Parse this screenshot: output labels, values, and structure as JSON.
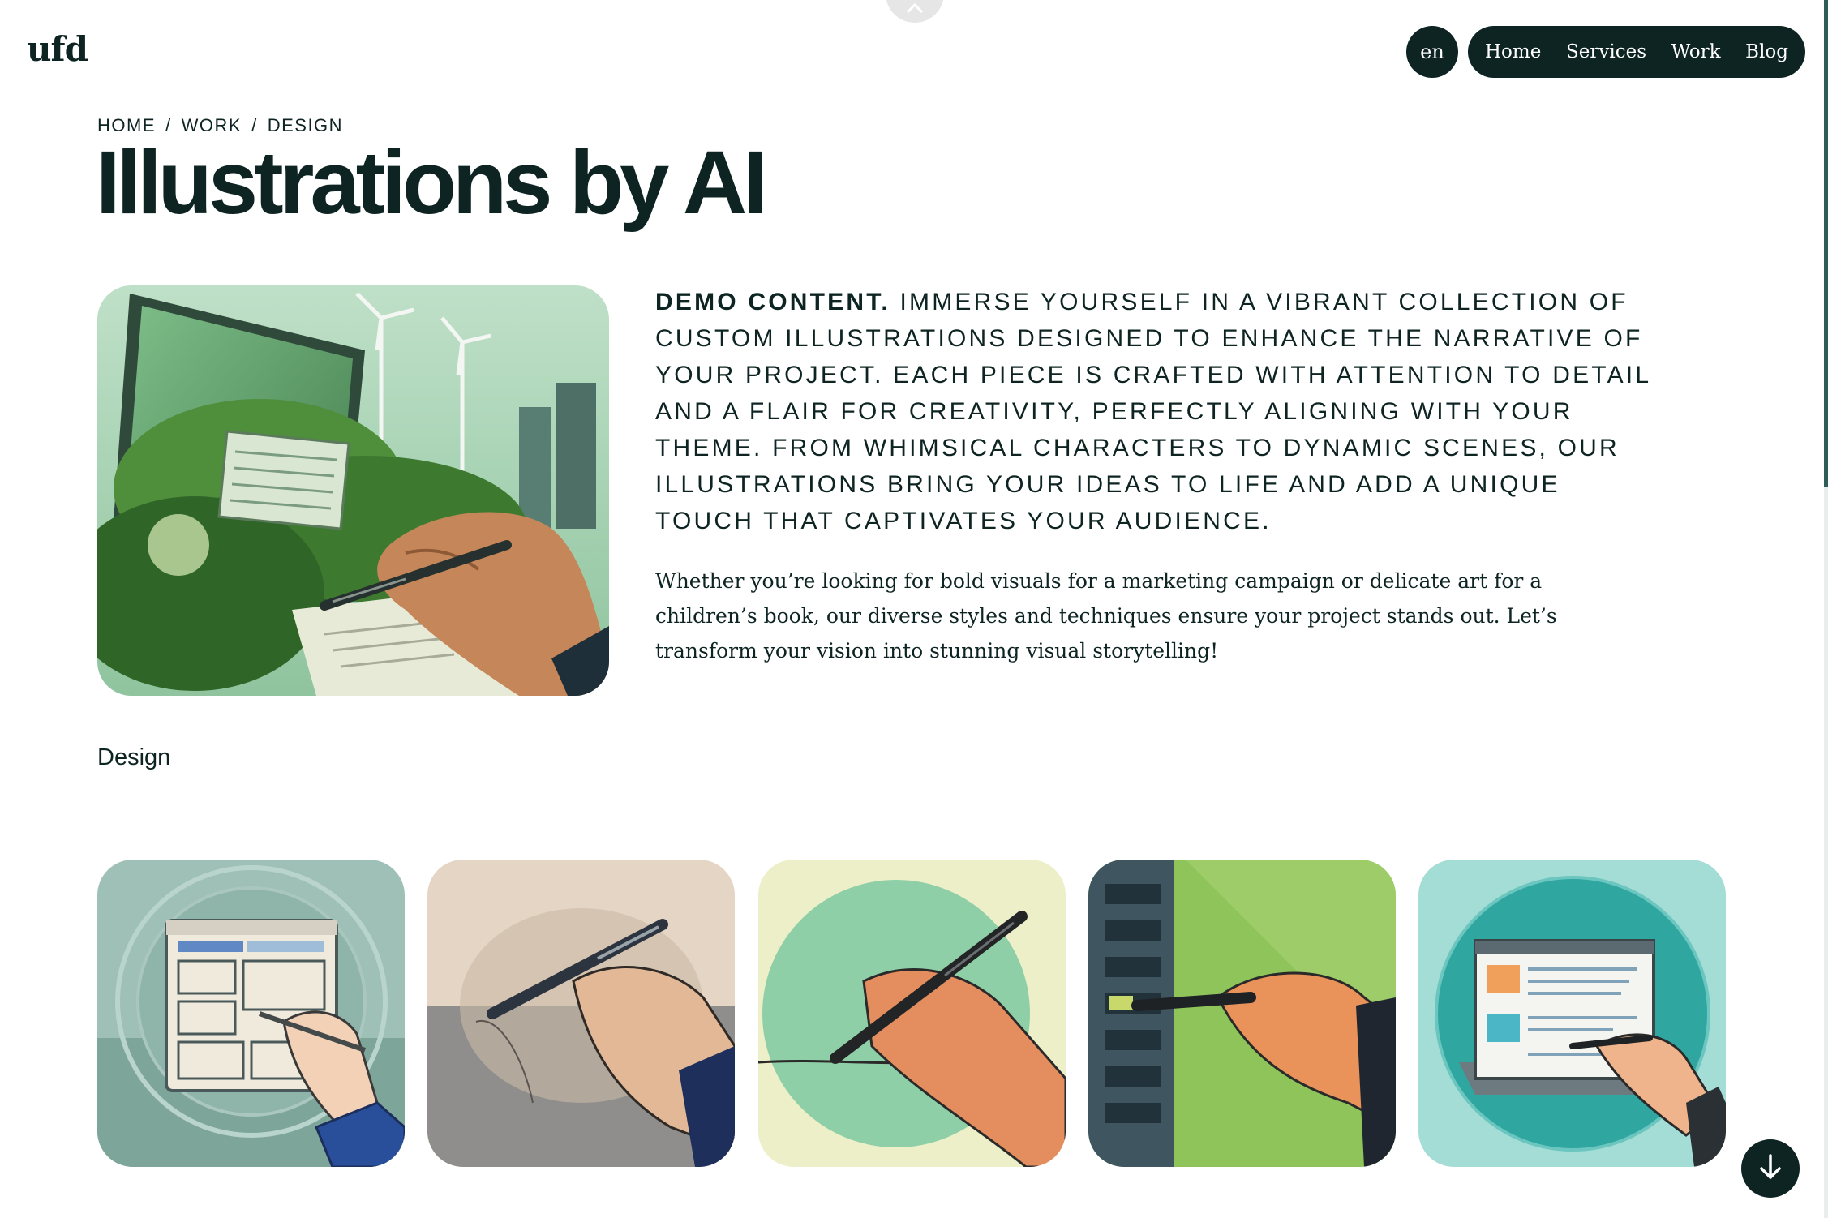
{
  "header": {
    "logo": "ufd",
    "language": "en",
    "nav": [
      "Home",
      "Services",
      "Work",
      "Blog"
    ]
  },
  "breadcrumb": {
    "items": [
      "HOME",
      "WORK",
      "DESIGN"
    ],
    "separator": "/"
  },
  "page_title": "Illustrations by AI",
  "intro": {
    "lead_bold": "DEMO CONTENT.",
    "lead_text": "IMMERSE YOURSELF IN A VIBRANT COLLECTION OF CUSTOM ILLUSTRATIONS DESIGNED TO ENHANCE THE NARRATIVE OF YOUR PROJECT. EACH PIECE IS CRAFTED WITH ATTENTION TO DETAIL AND A FLAIR FOR CREATIVITY, PERFECTLY ALIGNING WITH YOUR THEME. FROM WHIMSICAL CHARACTERS TO DYNAMIC SCENES, OUR ILLUSTRATIONS BRING YOUR IDEAS TO LIFE AND ADD A UNIQUE TOUCH THAT CAPTIVATES YOUR AUDIENCE.",
    "body": "Whether you’re looking for bold visuals for a marketing campaign or delicate art for a children’s book, our diverse styles and techniques ensure your project stands out. Let’s transform your vision into stunning visual storytelling!"
  },
  "category_tag": "Design",
  "gallery": [
    {
      "icon": "wireframe-hand-illustration"
    },
    {
      "icon": "pen-hand-halftone-illustration"
    },
    {
      "icon": "pen-hand-green-circle-illustration"
    },
    {
      "icon": "server-rack-hand-illustration"
    },
    {
      "icon": "webpage-hand-teal-illustration"
    }
  ],
  "icons": {
    "top": "chevron-up-icon",
    "scroll": "arrow-down-icon"
  },
  "colors": {
    "primary": "#0d2422",
    "background": "#ffffff",
    "accent": "#2e5e57"
  }
}
